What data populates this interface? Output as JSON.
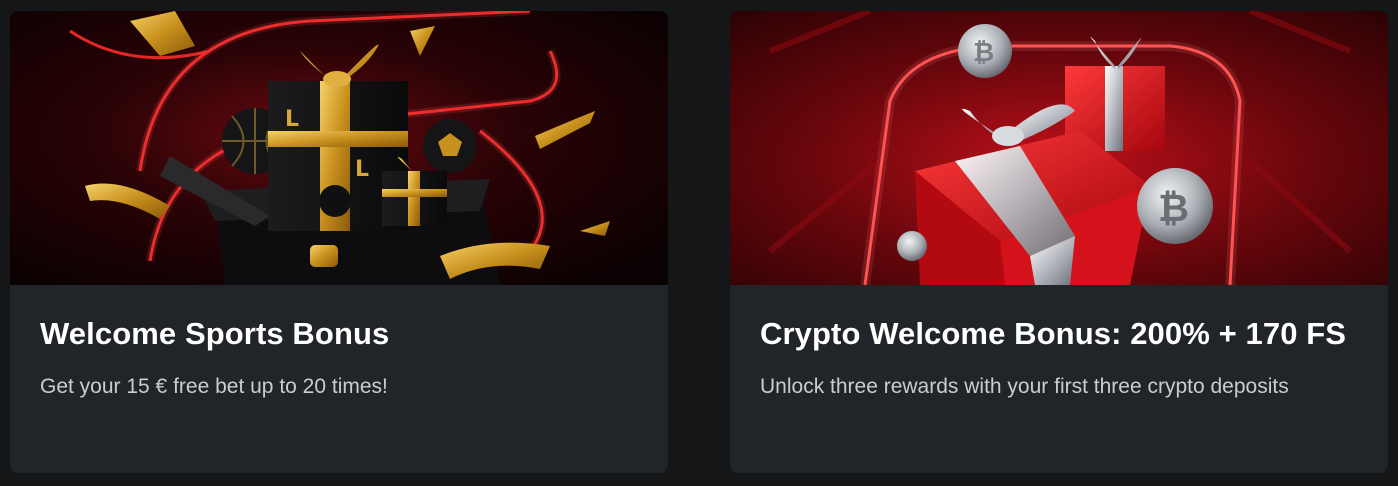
{
  "promos": [
    {
      "title": "Welcome Sports Bonus",
      "description": "Get your 15 € free bet up to 20 times!",
      "image_icon": "gift-box-sports-illustration"
    },
    {
      "title": "Crypto Welcome Bonus: 200% + 170 FS",
      "description": "Unlock three rewards with your first three crypto deposits",
      "image_icon": "gift-box-crypto-illustration"
    }
  ],
  "colors": {
    "page_background": "#141618",
    "card_background": "#212529",
    "accent_red": "#e0141e",
    "gold": "#d4a020",
    "title_text": "#ffffff",
    "description_text": "#c9ccd1"
  }
}
